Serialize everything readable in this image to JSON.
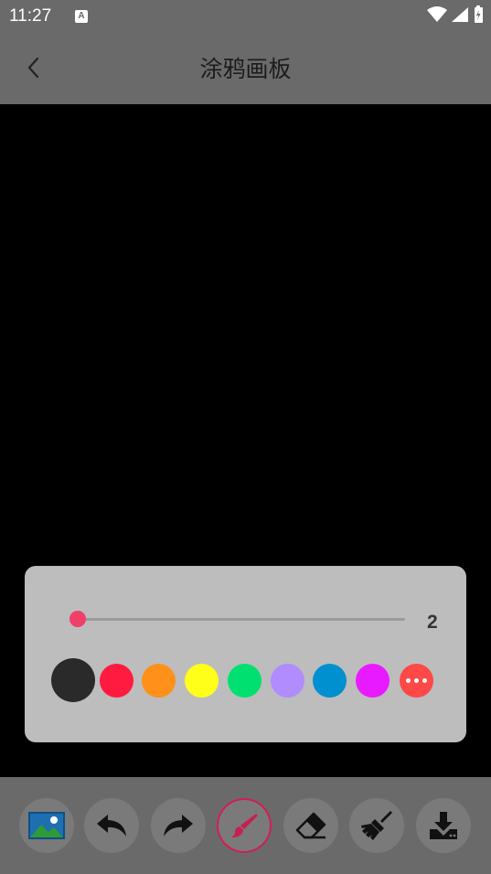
{
  "status_bar": {
    "time": "11:27",
    "notification_letter": "A"
  },
  "app_bar": {
    "title": "涂鸦画板",
    "back_icon": "chevron-left-icon"
  },
  "brush_panel": {
    "size_value": "2",
    "slider_fraction": 0.0,
    "colors": [
      "#2a2a2a",
      "#ff1a40",
      "#ff901a",
      "#ffff1a",
      "#00e070",
      "#b08cff",
      "#0090d0",
      "#e81aff"
    ],
    "selected_color": "#2a2a2a",
    "more_button_color": "#ff4848"
  },
  "toolbar": {
    "tools": [
      "image-icon",
      "undo-icon",
      "redo-icon",
      "brush-icon",
      "eraser-icon",
      "clear-icon",
      "download-icon"
    ],
    "active_tool": "brush-icon"
  }
}
